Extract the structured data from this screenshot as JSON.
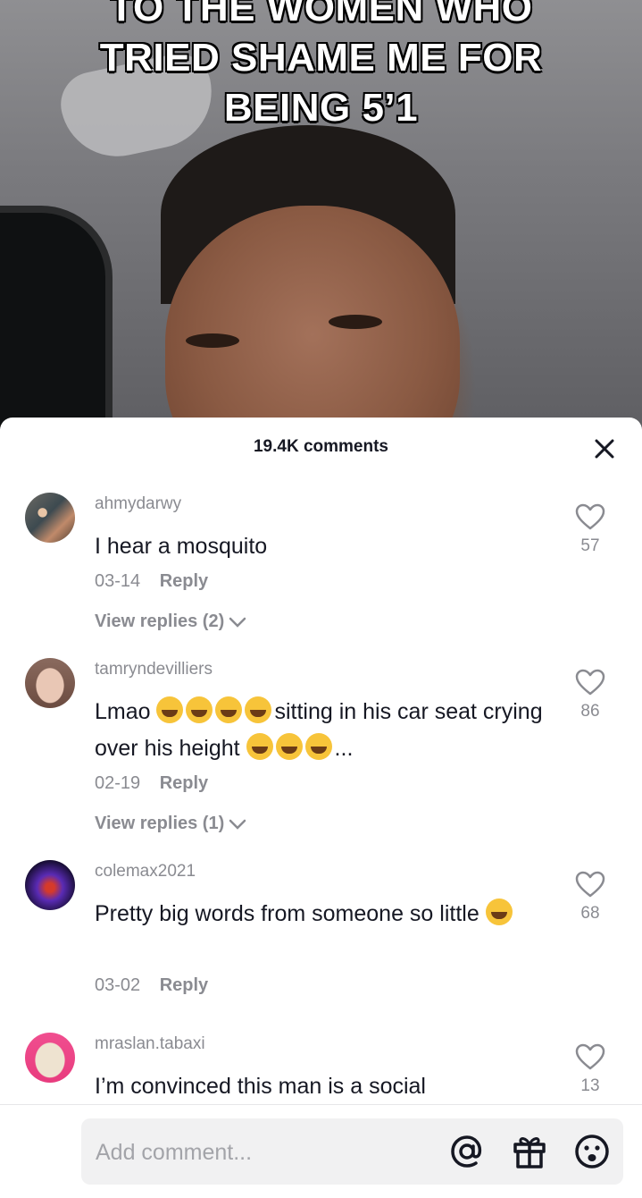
{
  "video": {
    "overlay_lines": [
      "TO THE WOMEN WHO",
      "TRIED SHAME ME FOR",
      "BEING 5’1"
    ]
  },
  "sheet": {
    "title": "19.4K comments",
    "close_icon": "close-icon"
  },
  "comments": [
    {
      "username": "ahmydarwy",
      "text": "I hear a mosquito",
      "date": "03-14",
      "reply_label": "Reply",
      "likes": "57",
      "view_replies": "View replies (2)"
    },
    {
      "username": "tamryndevilliers",
      "text_part1": "Lmao ",
      "text_part2": "sitting in his car seat crying over his height ",
      "text_ellipsis": "...",
      "date": "02-19",
      "reply_label": "Reply",
      "likes": "86",
      "view_replies": "View replies (1)"
    },
    {
      "username": "colemax2021",
      "text": "Pretty big words from someone so little ",
      "date": "03-02",
      "reply_label": "Reply",
      "likes": "68"
    },
    {
      "username": "mraslan.tabaxi",
      "text": "I’m convinced this man is a social",
      "likes": "13"
    }
  ],
  "footer": {
    "placeholder": "Add comment...",
    "icons": [
      "at-icon",
      "gift-icon",
      "emoji-icon"
    ]
  },
  "colors": {
    "primary_text": "#161823",
    "secondary_text": "#8a8b91",
    "input_bg": "#f1f1f2"
  }
}
